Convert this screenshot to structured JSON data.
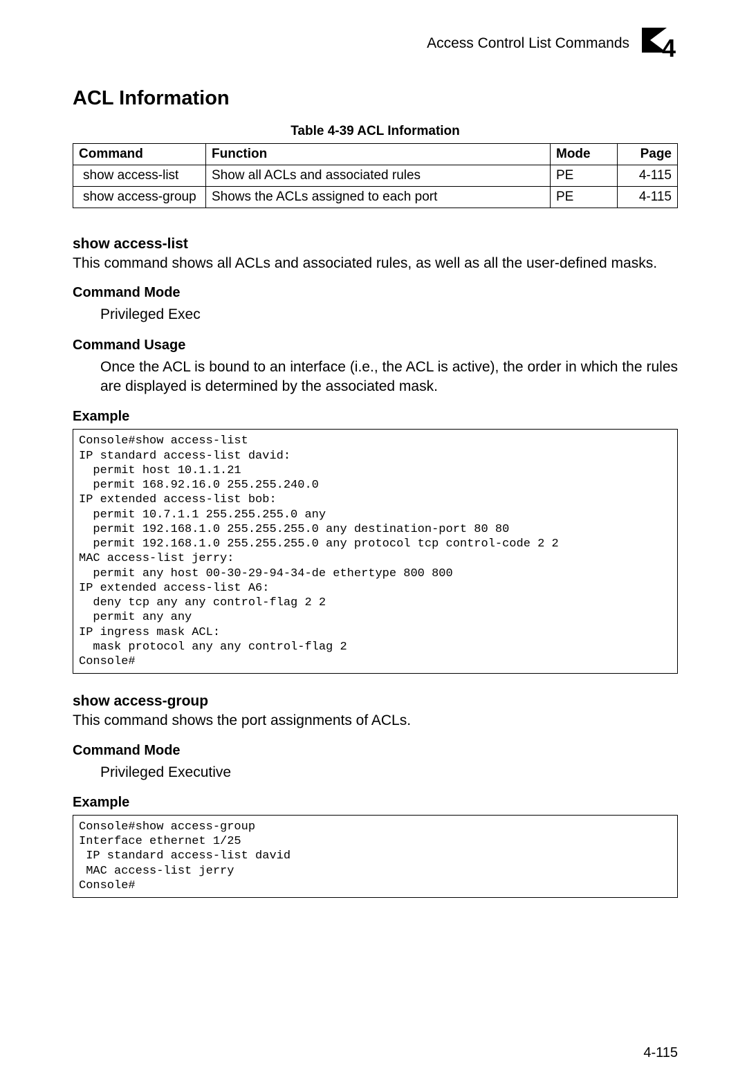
{
  "header": {
    "breadcrumb": "Access Control List Commands",
    "chapter_number": "4"
  },
  "section_title": "ACL Information",
  "table": {
    "caption": "Table 4-39  ACL Information",
    "headers": {
      "command": "Command",
      "function": "Function",
      "mode": "Mode",
      "page": "Page"
    },
    "rows": [
      {
        "command": "show access-list",
        "function": "Show all ACLs and associated rules",
        "mode": "PE",
        "page": "4-115"
      },
      {
        "command": "show access-group",
        "function": "Shows the ACLs assigned to each port",
        "mode": "PE",
        "page": "4-115"
      }
    ]
  },
  "show_access_list": {
    "heading": "show access-list",
    "desc": "This command shows all ACLs and associated rules, as well as all the user-defined masks.",
    "command_mode_label": "Command Mode",
    "command_mode_value": "Privileged Exec",
    "command_usage_label": "Command Usage",
    "command_usage_value": "Once the ACL is bound to an interface (i.e., the ACL is active), the order in which the rules are displayed is determined by the associated mask.",
    "example_label": "Example",
    "example_text": "Console#show access-list\nIP standard access-list david:\n  permit host 10.1.1.21\n  permit 168.92.16.0 255.255.240.0\nIP extended access-list bob:\n  permit 10.7.1.1 255.255.255.0 any\n  permit 192.168.1.0 255.255.255.0 any destination-port 80 80\n  permit 192.168.1.0 255.255.255.0 any protocol tcp control-code 2 2\nMAC access-list jerry:\n  permit any host 00-30-29-94-34-de ethertype 800 800\nIP extended access-list A6:\n  deny tcp any any control-flag 2 2\n  permit any any\nIP ingress mask ACL:\n  mask protocol any any control-flag 2\nConsole#"
  },
  "show_access_group": {
    "heading": "show access-group",
    "desc": "This command shows the port assignments of ACLs.",
    "command_mode_label": "Command Mode",
    "command_mode_value": "Privileged Executive",
    "example_label": "Example",
    "example_text": "Console#show access-group\nInterface ethernet 1/25\n IP standard access-list david\n MAC access-list jerry\nConsole#"
  },
  "page_number": "4-115"
}
